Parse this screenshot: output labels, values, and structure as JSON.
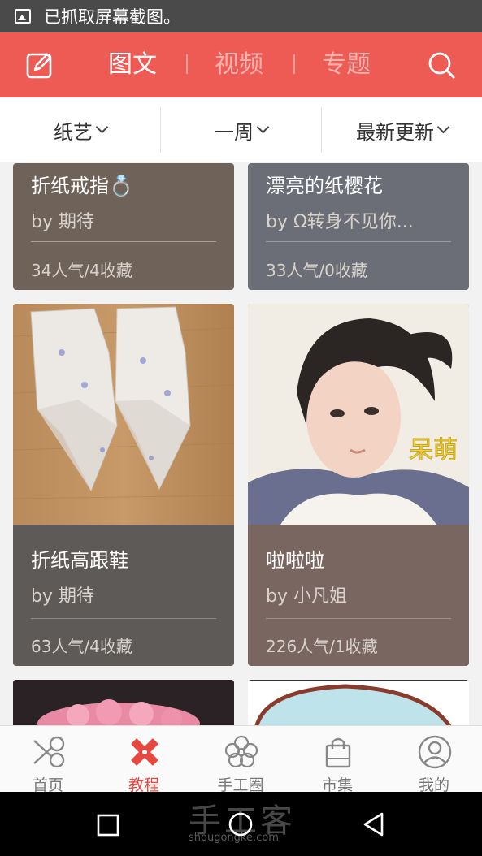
{
  "status_bar": {
    "text": "已抓取屏幕截图。"
  },
  "header": {
    "tabs": [
      {
        "label": "图文",
        "active": true
      },
      {
        "label": "视频",
        "active": false
      },
      {
        "label": "专题",
        "active": false
      }
    ],
    "accent": "#ee5a54"
  },
  "filters": [
    {
      "label": "纸艺"
    },
    {
      "label": "一周"
    },
    {
      "label": "最新更新"
    }
  ],
  "cards": [
    {
      "title": "折纸戒指💍",
      "author": "by 期待",
      "stats": "34人气/4收藏",
      "color": "#6f6259"
    },
    {
      "title": "漂亮的纸樱花",
      "author": "by Ω转身不见你...",
      "stats": "33人气/0收藏",
      "color": "#6b6e76"
    },
    {
      "title": "折纸高跟鞋",
      "author": "by 期待",
      "stats": "63人气/4收藏",
      "color": "#5e5a57"
    },
    {
      "title": "啦啦啦",
      "author": "by 小凡姐",
      "stats": "226人气/1收藏",
      "color": "#7a6660",
      "image_text": "呆萌"
    }
  ],
  "bottom_nav": [
    {
      "label": "首页",
      "icon": "scissors-icon",
      "active": false
    },
    {
      "label": "教程",
      "icon": "pencil-ruler-icon",
      "active": true
    },
    {
      "label": "手工圈",
      "icon": "flower-icon",
      "active": false
    },
    {
      "label": "市集",
      "icon": "shopping-bag-icon",
      "active": false
    },
    {
      "label": "我的",
      "icon": "user-icon",
      "active": false
    }
  ],
  "watermark": {
    "main": "手工客",
    "sub": "shougongke.com"
  }
}
